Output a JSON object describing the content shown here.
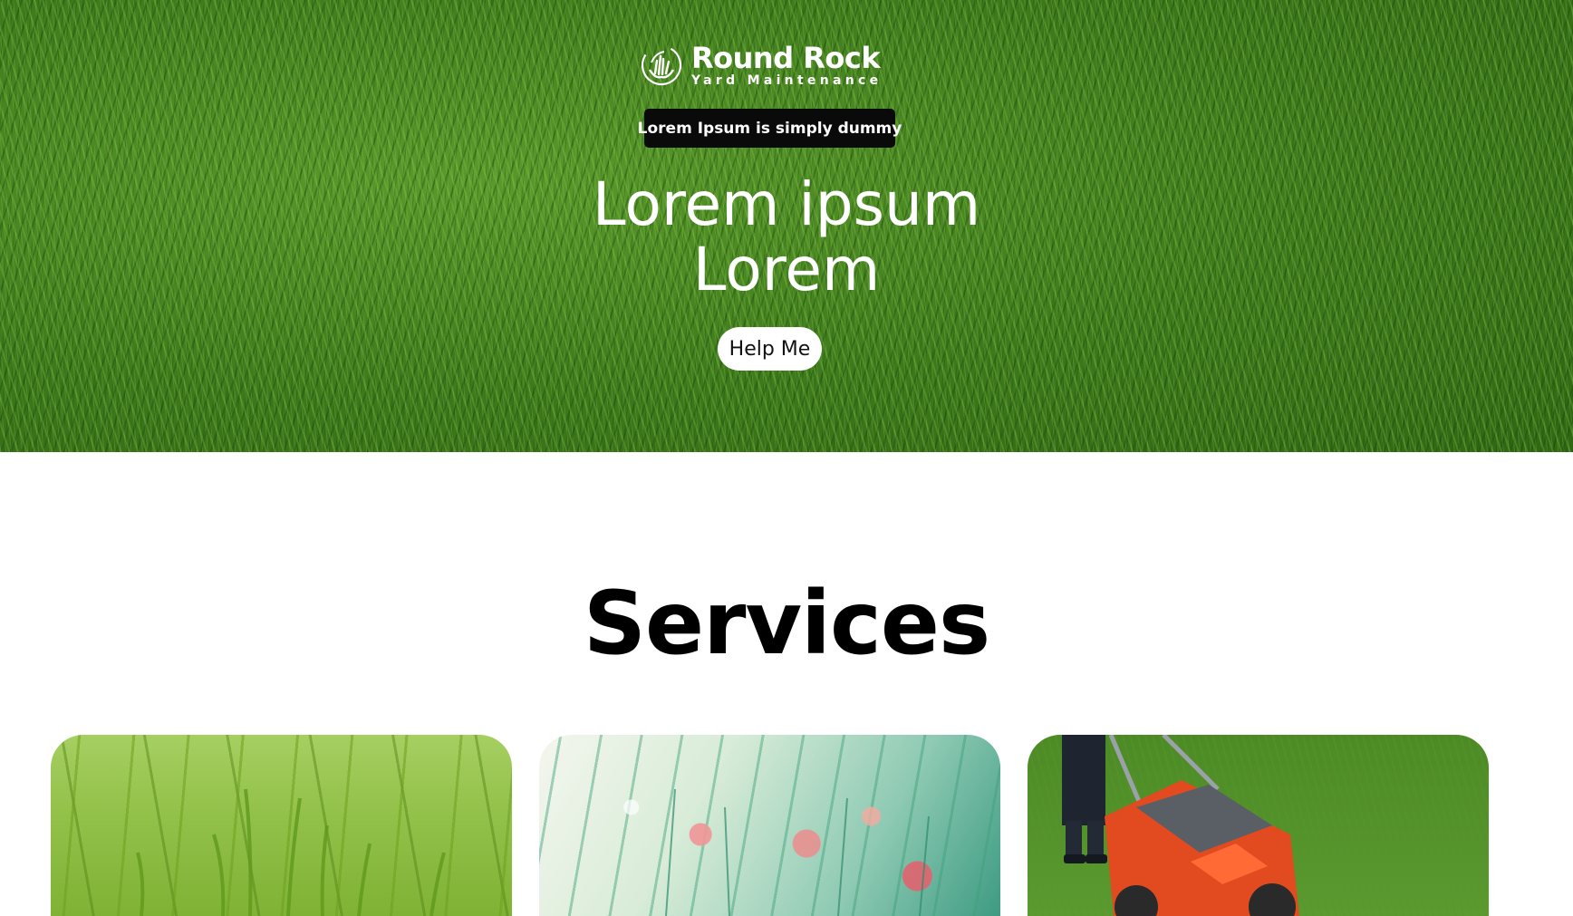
{
  "brand": {
    "name": "Round Rock",
    "subtitle": "Yard Maintenance",
    "icon": "grass-hands-icon"
  },
  "hero": {
    "tagline": "Lorem Ipsum is simply dummy",
    "title_line1": "Lorem ipsum",
    "title_line2": "Lorem",
    "cta_label": "Help Me"
  },
  "services": {
    "title": "Services",
    "cards": [
      {
        "image": "tall-grass-image"
      },
      {
        "image": "wildflowers-image"
      },
      {
        "image": "lawn-mower-image"
      }
    ]
  },
  "colors": {
    "hero_green": "#3f7d1f",
    "tag_bg": "#0a0a0a",
    "button_bg": "#ffffff",
    "text_dark": "#000000"
  }
}
